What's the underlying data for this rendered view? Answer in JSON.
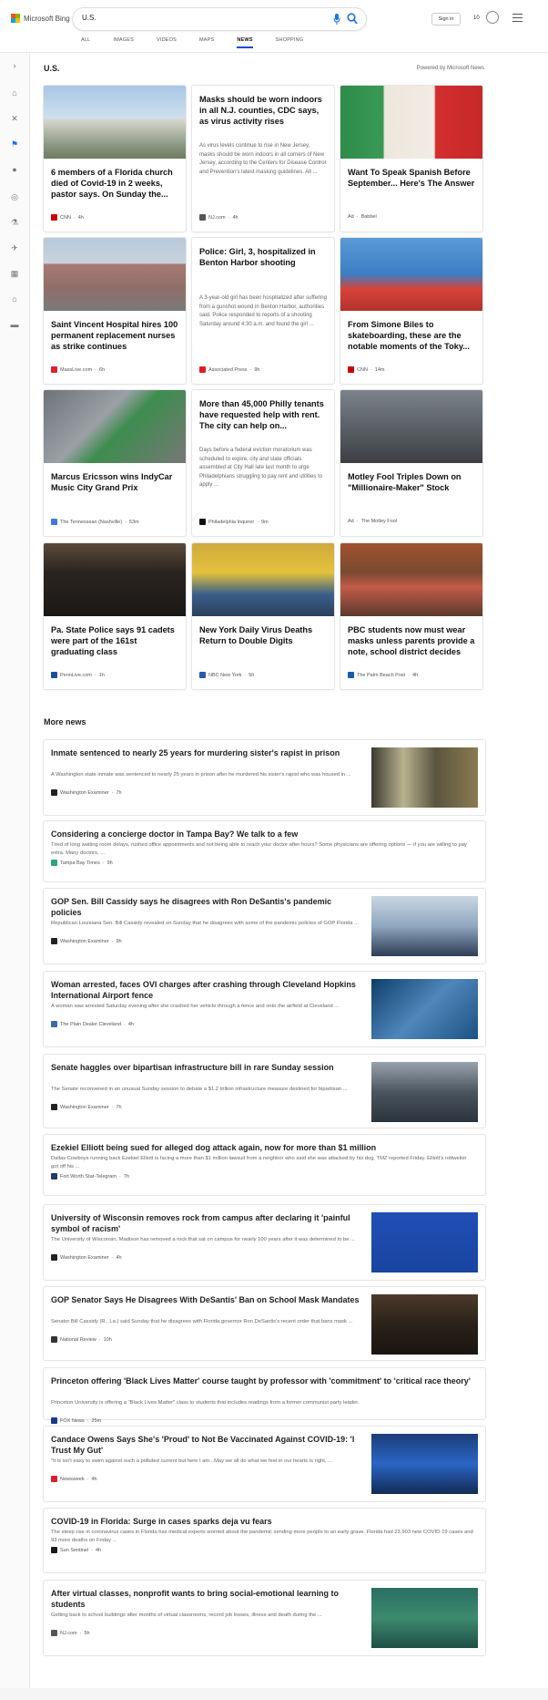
{
  "brand": "Microsoft Bing",
  "search": {
    "value": "U.S."
  },
  "header": {
    "signin": "Sign in",
    "points": "10"
  },
  "tabs": [
    "ALL",
    "IMAGES",
    "VIDEOS",
    "MAPS",
    "NEWS",
    "SHOPPING"
  ],
  "active_tab": "NEWS",
  "rail_icons": [
    "expand-icon",
    "home-icon",
    "science-icon",
    "flag-icon",
    "location-pin-icon",
    "globe-icon",
    "microscope-icon",
    "satellite-icon",
    "film-icon",
    "bank-icon",
    "card-icon"
  ],
  "section": {
    "title": "U.S.",
    "powered": "Powered by Microsoft News"
  },
  "cards": [
    {
      "title": "6 members of a Florida church died of Covid-19 in 2 weeks, pastor says. On Sunday the...",
      "desc": "",
      "source": "CNN",
      "time": "4h",
      "img": "building",
      "icon_color": "#cc0000"
    },
    {
      "title": "Masks should be worn indoors in all N.J. counties, CDC says, as virus activity rises",
      "desc": "As virus levels continue to rise in New Jersey, masks should be worn indoors in all corners of New Jersey, according to the Centers for Disease Control and Prevention's latest masking guidelines. All ...",
      "source": "NJ.com",
      "time": "4h",
      "img": "",
      "icon_color": "#555555"
    },
    {
      "title": "Want To Speak Spanish Before September... Here's The Answer",
      "desc": "",
      "source": "Babbel",
      "time": "",
      "ad": "Ad",
      "img": "woman",
      "icon_color": ""
    },
    {
      "title": "Saint Vincent Hospital hires 100 permanent replacement nurses as strike continues",
      "desc": "",
      "source": "MassLive.com",
      "time": "6h",
      "img": "hospital",
      "icon_color": "#d8232a"
    },
    {
      "title": "Police: Girl, 3, hospitalized in Benton Harbor shooting",
      "desc": "A 3-year-old girl has been hospitalized after suffering from a gunshot wound in Benton Harbor, authorities said. Police responded to reports of a shooting Saturday around 4:30 a.m. and found the girl ...",
      "source": "Associated Press",
      "time": "9h",
      "img": "",
      "icon_color": "#e31b23"
    },
    {
      "title": "From Simone Biles to skateboarding, these are the notable moments of the Toky...",
      "desc": "",
      "source": "CNN",
      "time": "14m",
      "img": "gymnast",
      "icon_color": "#cc0000"
    },
    {
      "title": "Marcus Ericsson wins IndyCar Music City Grand Prix",
      "desc": "",
      "source": "The Tennessean (Nashville)",
      "time": "53m",
      "img": "race",
      "icon_color": "#3a7bd5"
    },
    {
      "title": "More than 45,000 Philly tenants have requested help with rent. The city can help on...",
      "desc": "Days before a federal eviction moratorium was scheduled to expire, city and state officials assembled at City Hall late last month to urge Philadelphians struggling to pay rent and utilities to apply ...",
      "source": "Philadelphia Inquirer",
      "time": "9m",
      "img": "",
      "icon_color": "#111111"
    },
    {
      "title": "Motley Fool Triples Down on \"Millionaire-Maker\" Stock",
      "desc": "",
      "source": "The Motley Fool",
      "time": "",
      "ad": "Ad",
      "img": "cowboy",
      "icon_color": ""
    },
    {
      "title": "Pa. State Police says 91 cadets were part of the 161st graduating class",
      "desc": "",
      "source": "PennLive.com",
      "time": "1h",
      "img": "cadets",
      "icon_color": "#1b4f9c"
    },
    {
      "title": "New York Daily Virus Deaths Return to Double Digits",
      "desc": "",
      "source": "NBC New York",
      "time": "5h",
      "img": "crowd",
      "icon_color": "#2a56b5"
    },
    {
      "title": "PBC students now must wear masks unless parents provide a note, school district decides",
      "desc": "",
      "source": "The Palm Beach Post",
      "time": "4h",
      "img": "classroom",
      "icon_color": "#1d5aa8"
    }
  ],
  "more_news": {
    "title": "More news",
    "items": [
      {
        "title": "Inmate sentenced to nearly 25 years for murdering sister's rapist in prison",
        "snippet": "A Washington state inmate was sentenced to nearly 25 years in prison after he murdered his sister's rapist who was housed in ...",
        "source": "Washington Examiner",
        "time": "7h",
        "thumb": "prison",
        "icon_color": "#222222"
      },
      {
        "title": "Considering a concierge doctor in Tampa Bay? We talk to a few",
        "snippet": "Tired of long waiting room delays, rushed office appointments and not being able to reach your doctor after hours? Some physicians are offering options — if you are willing to pay extra. Many doctors, ...",
        "source": "Tampa Bay Times",
        "time": "9h",
        "thumb": "",
        "icon_color": "#2aa876"
      },
      {
        "title": "GOP Sen. Bill Cassidy says he disagrees with Ron DeSantis's pandemic policies",
        "snippet": "Republican Louisiana Sen. Bill Cassidy revealed on Sunday that he disagrees with some of the pandemic policies of GOP Florida ...",
        "source": "Washington Examiner",
        "time": "9h",
        "thumb": "senator",
        "icon_color": "#222222"
      },
      {
        "title": "Woman arrested, faces OVI charges after crashing through Cleveland Hopkins International Airport fence",
        "snippet": "A woman was arrested Saturday evening after she crashed her vehicle through a fence and onto the airfield at Cleveland ...",
        "source": "The Plain Dealer Cleveland",
        "time": "4h",
        "thumb": "plane",
        "icon_color": "#3b6ea5"
      },
      {
        "title": "Senate haggles over bipartisan infrastructure bill in rare Sunday session",
        "snippet": "The Senate reconvened in an unusual Sunday session to debate a $1.2 trillion infrastructure measure destined for bipartisan ...",
        "source": "Washington Examiner",
        "time": "7h",
        "thumb": "senate",
        "icon_color": "#222222"
      },
      {
        "title": "Ezekiel Elliott being sued for alleged dog attack again, now for more than $1 million",
        "snippet": "Dallas Cowboys running back Ezekiel Elliott is facing a more than $1 million lawsuit from a neighbor who said she was attacked by his dog, TMZ reported Friday. Elliott's rottweiler got off his ...",
        "source": "Fort Worth Star-Telegram",
        "time": "7h",
        "thumb": "",
        "icon_color": "#1f3a6b"
      },
      {
        "title": "University of Wisconsin removes rock from campus after declaring it 'painful symbol of racism'",
        "snippet": "The University of Wisconsin, Madison has removed a rock that sat on campus for nearly 100 years after it was determined to be ...",
        "source": "Washington Examiner",
        "time": "4h",
        "thumb": "flag",
        "icon_color": "#222222"
      },
      {
        "title": "GOP Senator Says He Disagrees With DeSantis' Ban on School Mask Mandates",
        "snippet": "Senator Bill Cassidy (R., La.) said Sunday that he disagrees with Florida governor Ron DeSantis's recent order that bans mask ...",
        "source": "National Review",
        "time": "10h",
        "thumb": "gov",
        "icon_color": "#333333"
      },
      {
        "title": "Princeton offering 'Black Lives Matter' course taught by professor with 'commitment' to 'critical race theory'",
        "snippet": "Princeton University is offering a \"Black Lives Matter\" class to students that includes readings from a former communist party leader.",
        "source": "FOX News",
        "time": "25m",
        "thumb": "",
        "icon_color": "#1a3b8a"
      },
      {
        "title": "Candace Owens Says She's 'Proud' to Not Be Vaccinated Against COVID-19: 'I Trust My Gut'",
        "snippet": "\"It is isn't easy to swim against such a polluted current but here I am...May we all do what we feel in our hearts is right, ...",
        "source": "Newsweek",
        "time": "4h",
        "thumb": "tv",
        "icon_color": "#d6202a"
      },
      {
        "title": "COVID-19 in Florida: Surge in cases sparks deja vu fears",
        "snippet": "The steep rise in coronavirus cases in Florida has medical experts worried about the pandemic sending more people to an early grave. Florida had 23,903 new COVID-19 cases and 93 more deaths on Friday ...",
        "source": "Sun Sentinel",
        "time": "4h",
        "thumb": "",
        "icon_color": "#1a1a1a"
      },
      {
        "title": "After virtual classes, nonprofit wants to bring social-emotional learning to students",
        "snippet": "Getting back to school buildings after months of virtual classrooms, record job losses, illness and death during the ...",
        "source": "NJ.com",
        "time": "5h",
        "thumb": "bright",
        "icon_color": "#555555"
      }
    ]
  },
  "footer_text": ""
}
